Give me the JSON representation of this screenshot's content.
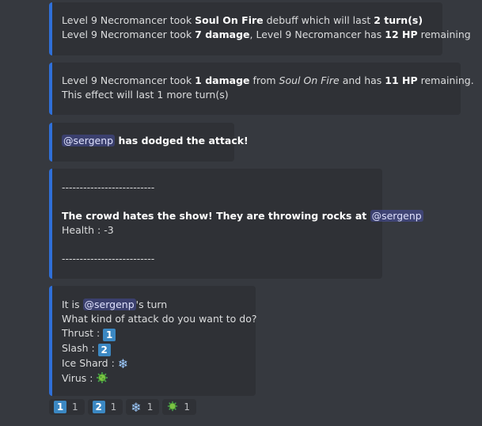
{
  "embed1": {
    "line1": {
      "pre": "Level 9 Necromancer took ",
      "debuff": "Soul On Fire",
      "mid": " debuff which will last ",
      "turns": "2 turn(s)"
    },
    "line2": {
      "pre": "Level 9 Necromancer took ",
      "damage": "7 damage",
      "mid": ", Level 9 Necromancer has ",
      "hp": "12 HP",
      "post": " remaining"
    }
  },
  "embed2": {
    "line1": {
      "pre": "Level 9 Necromancer took ",
      "damage": "1 damage",
      "from": " from ",
      "effect": "Soul On Fire",
      "mid": " and has ",
      "hp": "11 HP",
      "post": " remaining."
    },
    "line2": "This effect will last 1 more turn(s)"
  },
  "embed3": {
    "mention": "@sergenp",
    "text": " has dodged the attack!"
  },
  "embed4": {
    "divider": "--------------------------",
    "bold": "The crowd hates the show! They are throwing rocks at ",
    "mention": "@sergenp",
    "health": "Health : -3"
  },
  "embed5": {
    "it_is": "It is ",
    "mention": "@sergenp",
    "turn": "'s turn",
    "question": "What kind of attack do you want to do?",
    "options": [
      {
        "label": "Thrust : ",
        "emoji": "1"
      },
      {
        "label": "Slash : ",
        "emoji": "2"
      },
      {
        "label": "Ice Shard : ",
        "emoji": "❄"
      },
      {
        "label": "Virus : ",
        "emoji": "virus-icon"
      }
    ]
  },
  "reactions": [
    {
      "emoji": "1",
      "count": "1"
    },
    {
      "emoji": "2",
      "count": "1"
    },
    {
      "emoji": "❄",
      "count": "1"
    },
    {
      "emoji": "virus-icon",
      "count": "1"
    }
  ],
  "colors": {
    "background": "#36393f",
    "embed": "#2f3136",
    "accent": "#2f6fd8",
    "mention": "#dee0fc"
  }
}
